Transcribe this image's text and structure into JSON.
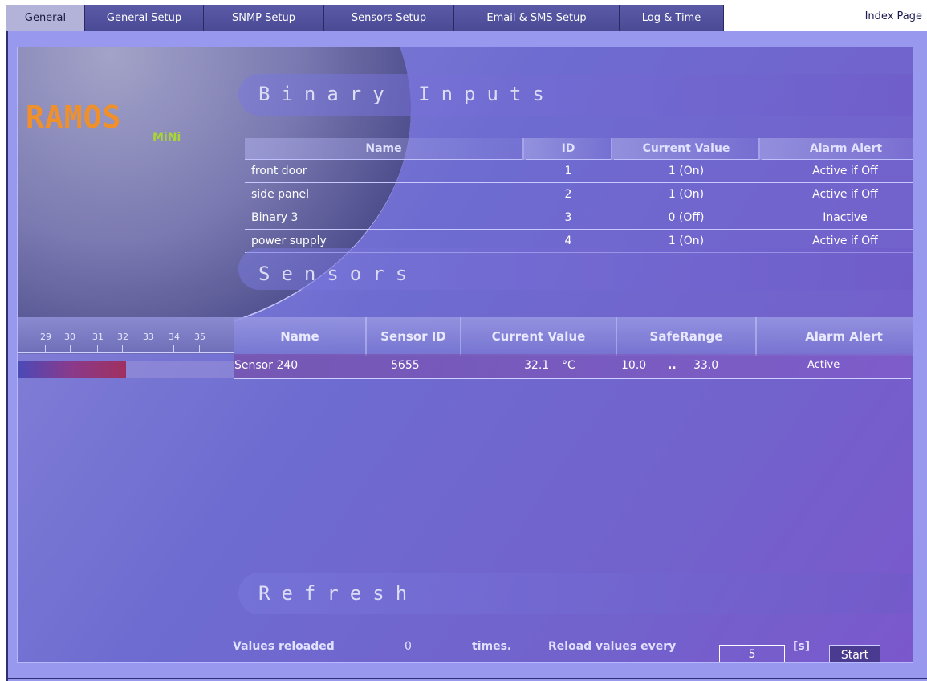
{
  "tabs": [
    {
      "label": "General"
    },
    {
      "label": "General Setup"
    },
    {
      "label": "SNMP Setup"
    },
    {
      "label": "Sensors Setup"
    },
    {
      "label": "Email & SMS Setup"
    },
    {
      "label": "Log & Time"
    }
  ],
  "index_link": "Index Page",
  "logo": {
    "main": "RAMOS",
    "sub": "MiNi"
  },
  "binary_inputs": {
    "title": "Binary Inputs",
    "columns": [
      "Name",
      "ID",
      "Current Value",
      "Alarm Alert"
    ],
    "rows": [
      {
        "name": "front door",
        "id": "1",
        "value": "1 (On)",
        "alert": "Active if Off"
      },
      {
        "name": "side panel",
        "id": "2",
        "value": "1 (On)",
        "alert": "Active if Off"
      },
      {
        "name": "Binary 3",
        "id": "3",
        "value": "0 (Off)",
        "alert": "Inactive"
      },
      {
        "name": "power supply",
        "id": "4",
        "value": "1 (On)",
        "alert": "Active if Off"
      }
    ]
  },
  "sensors": {
    "title": "Sensors",
    "scale": [
      "29",
      "30",
      "31",
      "32",
      "33",
      "34",
      "35"
    ],
    "columns": [
      "Name",
      "Sensor ID",
      "Current Value",
      "SafeRange",
      "Alarm Alert"
    ],
    "rows": [
      {
        "name": "Sensor 240",
        "id": "5655",
        "value": "32.1",
        "unit": "°C",
        "range_low": "10.0",
        "range_sep": "..",
        "range_high": "33.0",
        "alert": "Active",
        "bar_fraction": 0.5
      }
    ]
  },
  "refresh": {
    "title": "Refresh",
    "reloaded_label": "Values reloaded",
    "reloaded_count": "0",
    "times_label": "times.",
    "reload_label": "Reload values every",
    "interval": "5",
    "unit_label": "[s]",
    "start_label": "Start"
  },
  "colors": {
    "panel": "#9898ee",
    "accent_orange": "#f0902a",
    "accent_green": "#a8d830"
  }
}
